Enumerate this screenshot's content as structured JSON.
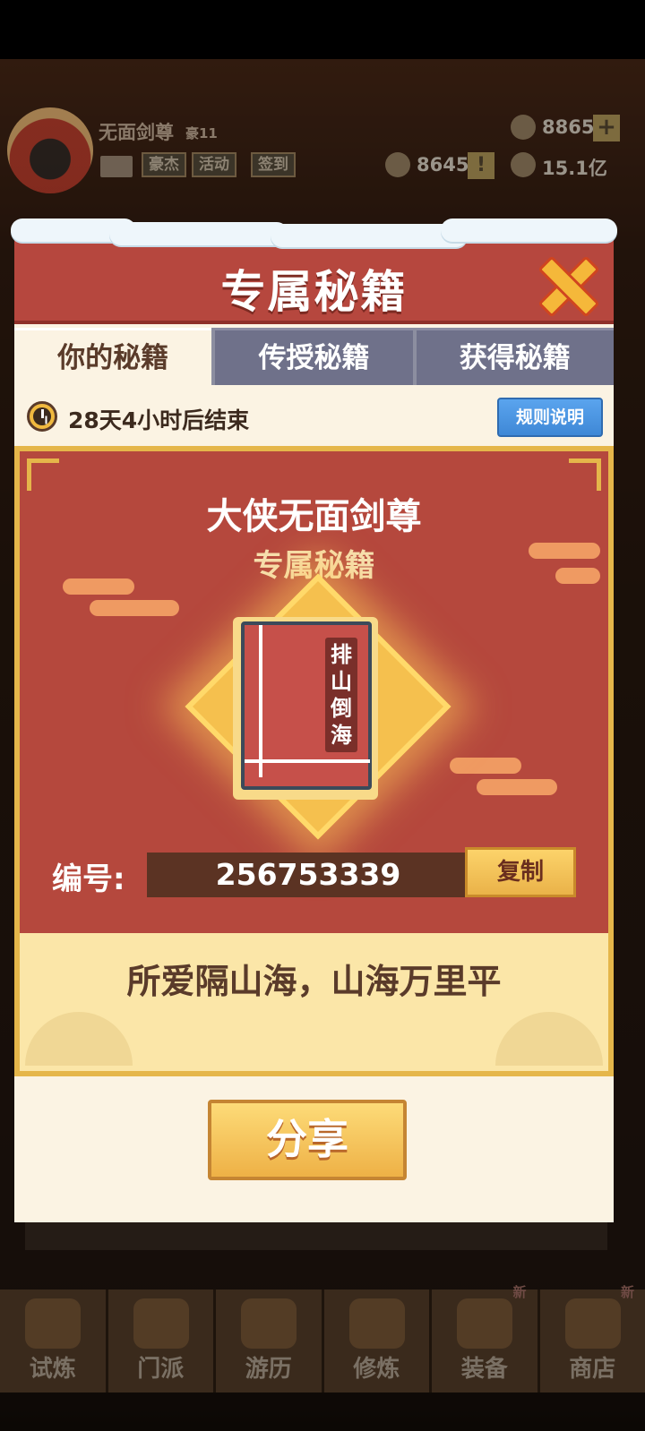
{
  "hud": {
    "player_name": "无面剑尊",
    "player_rank": "豪11",
    "chips": [
      "豪杰",
      "活动",
      "签到"
    ],
    "gems": "8865",
    "power": "8645",
    "gold": "15.1亿"
  },
  "dialog": {
    "title": "专属秘籍",
    "tabs": [
      {
        "label": "你的秘籍",
        "active": true
      },
      {
        "label": "传授秘籍",
        "active": false
      },
      {
        "label": "获得秘籍",
        "active": false
      }
    ],
    "timer_text": "28天4小时后结束",
    "rules_button": "规则说明",
    "panel_title": "大侠无面剑尊",
    "panel_subtitle": "专属秘籍",
    "book_name": "排山倒海",
    "code_label": "编号:",
    "code_value": "256753339",
    "copy_button": "复制",
    "poem": "所爱隔山海，山海万里平",
    "share_button": "分享"
  },
  "bottom_nav": [
    {
      "label": "试炼",
      "badge": ""
    },
    {
      "label": "门派",
      "badge": ""
    },
    {
      "label": "游历",
      "badge": ""
    },
    {
      "label": "修炼",
      "badge": ""
    },
    {
      "label": "装备",
      "badge": "新"
    },
    {
      "label": "商店",
      "badge": "新"
    }
  ],
  "colors": {
    "header_red": "#b6473e",
    "gold_frame": "#e5b64a",
    "tab_inactive": "#6f718a",
    "rules_blue": "#3f88d6"
  },
  "icons": [
    "clock-icon",
    "close-icon",
    "book-icon",
    "gem-icon",
    "coin-icon",
    "mail-icon"
  ]
}
